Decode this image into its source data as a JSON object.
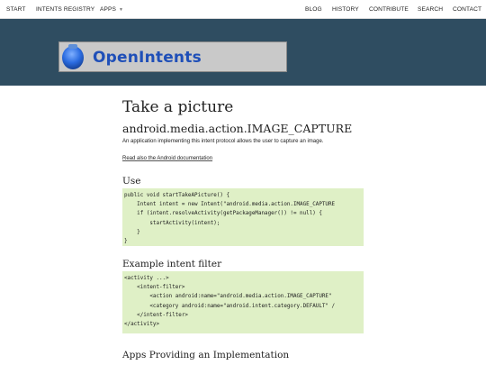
{
  "nav": {
    "start": "START",
    "intents_registry": "INTENTS REGISTRY",
    "apps": "APPS",
    "blog": "BLOG",
    "history": "HISTORY",
    "contribute": "CONTRIBUTE",
    "search": "SEARCH",
    "contact": "CONTACT"
  },
  "logo": {
    "text": "OpenIntents"
  },
  "page": {
    "title": "Take a picture",
    "action": "android.media.action.IMAGE_CAPTURE",
    "description": "An application implementing this intent protocol allows the user to capture an image.",
    "doc_link": "Read also the Android documentation"
  },
  "use": {
    "heading": "Use",
    "lines": [
      "public void startTakeAPicture() {",
      "    Intent intent = new Intent(\"android.media.action.IMAGE_CAPTURE",
      "    if (intent.resolveActivity(getPackageManager()) != null) {",
      "        startActivity(intent);",
      "    }",
      "}"
    ]
  },
  "filter": {
    "heading": "Example intent filter",
    "lines": [
      "<activity ...>",
      "    <intent-filter>",
      "        <action android:name=\"android.media.action.IMAGE_CAPTURE\" ",
      "        <category android:name=\"android.intent.category.DEFAULT\" /",
      "    </intent-filter>",
      "</activity>"
    ]
  },
  "apps_section": {
    "heading": "Apps Providing an Implementation"
  },
  "colors": {
    "banner": "#2f4d61",
    "code_bg": "#dff0c6",
    "logo_text": "#1f4fb8"
  },
  "icons": {
    "logo": "openintents-logo-icon",
    "apps_caret": "chevron-down-icon"
  }
}
